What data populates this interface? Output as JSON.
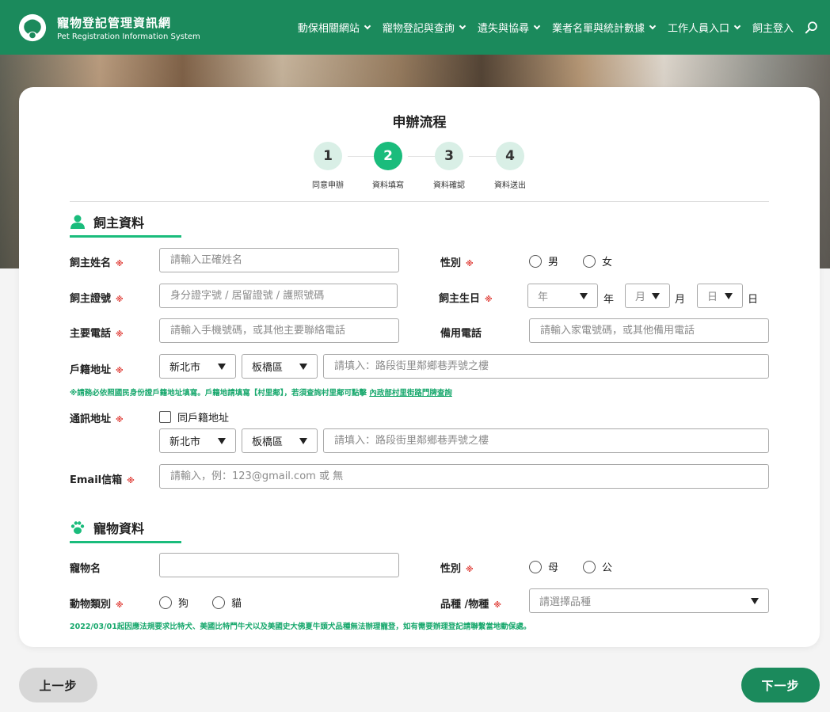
{
  "header": {
    "title_zh": "寵物登記管理資訊網",
    "title_en": "Pet Registration Information System",
    "nav": [
      {
        "label": "動保相關網站",
        "dropdown": true
      },
      {
        "label": "寵物登記與查詢",
        "dropdown": true
      },
      {
        "label": "遺失與協尋",
        "dropdown": true
      },
      {
        "label": "業者名單與統計數據",
        "dropdown": true
      },
      {
        "label": "工作人員入口",
        "dropdown": true
      },
      {
        "label": "飼主登入",
        "dropdown": false
      }
    ]
  },
  "process": {
    "title": "申辦流程",
    "steps": [
      {
        "number": "1",
        "label": "同意申辦",
        "active": false
      },
      {
        "number": "2",
        "label": "資料填寫",
        "active": true
      },
      {
        "number": "3",
        "label": "資料確認",
        "active": false
      },
      {
        "number": "4",
        "label": "資料送出",
        "active": false
      }
    ]
  },
  "owner": {
    "section_title": "飼主資料",
    "required_mark": "※",
    "name": {
      "label": "飼主姓名",
      "placeholder": "請輸入正確姓名"
    },
    "gender": {
      "label": "性別",
      "options": [
        "男",
        "女"
      ]
    },
    "id_no": {
      "label": "飼主證號",
      "placeholder": "身分證字號 / 居留證號 / 護照號碼"
    },
    "birthday": {
      "label": "飼主生日",
      "year_placeholder": "年",
      "year_unit": "年",
      "month_placeholder": "月",
      "month_unit": "月",
      "day_placeholder": "日",
      "day_unit": "日"
    },
    "phone": {
      "label": "主要電話",
      "placeholder": "請輸入手機號碼，或其他主要聯絡電話"
    },
    "alt_phone": {
      "label": "備用電話",
      "placeholder": "請輸入家電號碼，或其他備用電話"
    },
    "household_address": {
      "label": "戶籍地址",
      "city": "新北市",
      "district": "板橋區",
      "placeholder": "請填入：路段街里鄰鄉巷弄號之樓"
    },
    "household_note": "※請務必依照國民身份證戶籍地址填寫。戶籍地請填寫【村里鄰】，若須查詢村里鄰可點擊",
    "household_note_link": "內政部村里街路門牌查詢",
    "mailing_address": {
      "label": "通訊地址",
      "same_as_label": "同戶籍地址",
      "city": "新北市",
      "district": "板橋區",
      "placeholder": "請填入：路段街里鄰鄉巷弄號之樓"
    },
    "email": {
      "label": "Email信箱",
      "placeholder": "請輸入，例：123@gmail.com 或 無"
    }
  },
  "pet": {
    "section_title": "寵物資料",
    "name": {
      "label": "寵物名",
      "value": ""
    },
    "gender": {
      "label": "性別",
      "options": [
        "母",
        "公"
      ]
    },
    "species": {
      "label": "動物類別",
      "options": [
        "狗",
        "貓"
      ]
    },
    "breed": {
      "label": "品種 /物種",
      "placeholder": "請選擇品種"
    },
    "note": "2022/03/01起因應法規要求比特犬、美國比特鬥牛犬以及美國史大佛夏牛頭犬品種無法辦理寵登，如有需要辦理登記請聯繫當地動保處。"
  },
  "actions": {
    "prev": "上一步",
    "next": "下一步"
  },
  "colors": {
    "primary": "#1b8a5c",
    "accent": "#1abc7c",
    "required": "#e0413b"
  }
}
